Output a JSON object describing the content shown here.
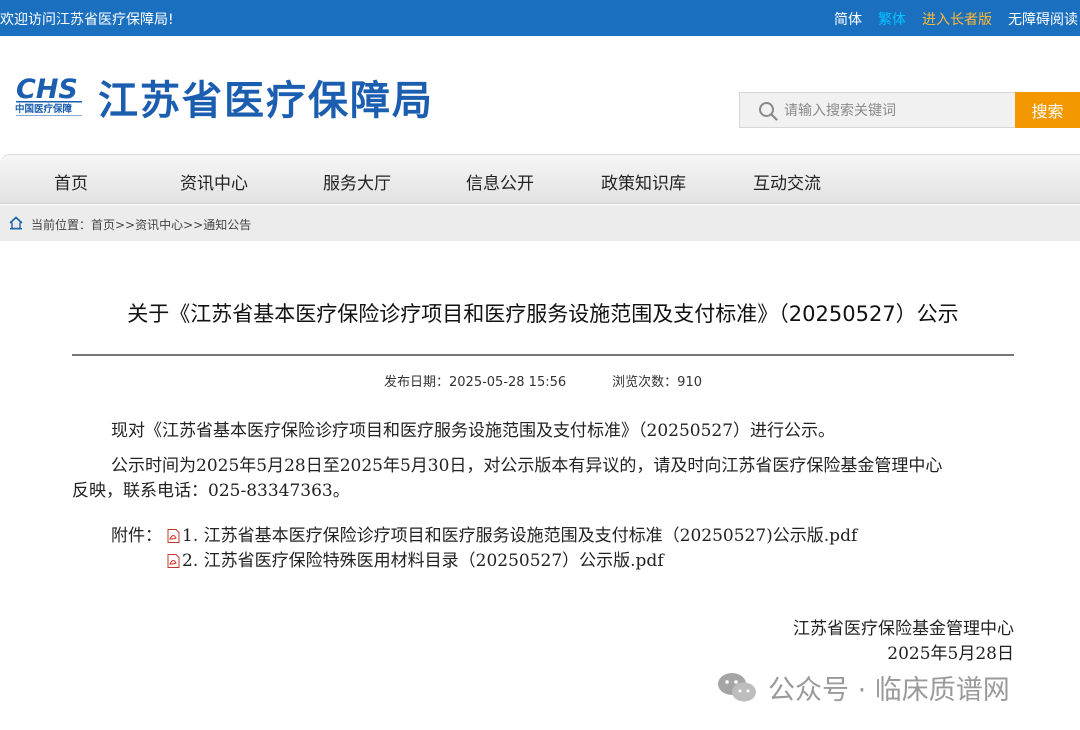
{
  "topbar": {
    "welcome": "欢迎访问江苏省医疗保障局!",
    "links": [
      "简体",
      "繁体",
      "进入长者版",
      "无障碍阅读"
    ],
    "link_colors": [
      "#ffffff",
      "#00c3ff",
      "#ffb833",
      "#ffffff"
    ]
  },
  "header": {
    "logo_text": "CHS",
    "logo_sub": "中国医疗保障",
    "site_title": "江苏省医疗保障局",
    "search_placeholder": "请输入搜索关键词",
    "search_button": "搜索"
  },
  "nav": {
    "items": [
      "首页",
      "资讯中心",
      "服务大厅",
      "信息公开",
      "政策知识库",
      "互动交流"
    ]
  },
  "breadcrumb": {
    "text": "当前位置：首页>>资讯中心>>通知公告"
  },
  "article": {
    "title": "关于《江苏省基本医疗保险诊疗项目和医疗服务设施范围及支付标准》（20250527）公示",
    "publish_label": "发布日期：",
    "publish_date": "2025-05-28 15:56",
    "views_label": "浏览次数：",
    "views": "910",
    "para1": "现对《江苏省基本医疗保险诊疗项目和医疗服务设施范围及支付标准》（20250527）进行公示。",
    "para2_line1": "公示时间为2025年5月28日至2025年5月30日，对公示版本有异议的，请及时向江苏省医疗保险基金管理中心",
    "para2_line2": "反映，联系电话：025-83347363。",
    "attach_label": "附件：",
    "attachments": [
      "1. 江苏省基本医疗保险诊疗项目和医疗服务设施范围及支付标准（20250527)公示版.pdf",
      "2. 江苏省医疗保险特殊医用材料目录（20250527）公示版.pdf"
    ],
    "signature_org": "江苏省医疗保险基金管理中心",
    "signature_date": "2025年5月28日"
  },
  "watermark": {
    "text": "公众号 · 临床质谱网"
  },
  "colors": {
    "topbar": "#1a6fbf",
    "brand_blue": "#1b5eb0",
    "search_button": "#f39800"
  }
}
